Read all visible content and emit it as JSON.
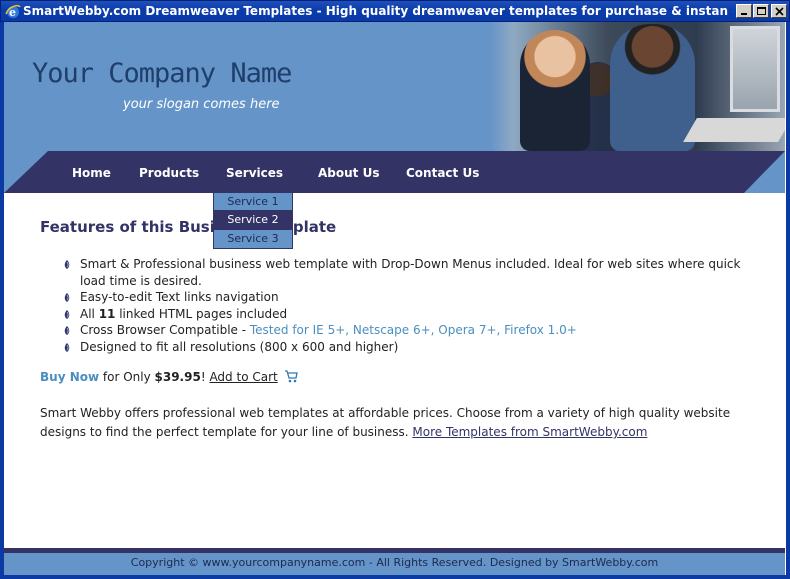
{
  "window": {
    "title": "SmartWebby.com Dreamweaver Templates - High quality dreamweaver templates for purchase & instan - Windows Interne...",
    "controls": [
      "minimize",
      "maximize",
      "close"
    ]
  },
  "header": {
    "company_name": "Your Company Name",
    "slogan": "your slogan comes here"
  },
  "nav": {
    "items": [
      {
        "label": "Home"
      },
      {
        "label": "Products"
      },
      {
        "label": "Services"
      },
      {
        "label": "About Us"
      },
      {
        "label": "Contact Us"
      }
    ]
  },
  "dropdown": {
    "items": [
      {
        "label": "Service 1"
      },
      {
        "label": "Service 2"
      },
      {
        "label": "Service 3"
      }
    ],
    "highlighted_index": 1
  },
  "content": {
    "heading": "Features of this Business Template",
    "features": [
      {
        "text": "Smart & Professional business web template with Drop-Down Menus included. Ideal for web sites where quick load time is desired."
      },
      {
        "text": "Easy-to-edit Text links navigation"
      },
      {
        "prefix": "All ",
        "bold": "11",
        "suffix": " linked HTML pages included"
      },
      {
        "text": "Cross Browser Compatible - ",
        "highlight": "Tested for IE 5+, Netscape 6+, Opera 7+, Firefox 1.0+"
      },
      {
        "text": "Designed to fit all resolutions (800 x 600 and higher)"
      }
    ],
    "buy": {
      "buy_now": "Buy Now",
      "for_only": " for Only ",
      "price": "$39.95",
      "excl": "! ",
      "add_to_cart": "Add to Cart"
    },
    "about": {
      "text": "Smart Webby offers professional web templates at affordable prices. Choose from a variety of high quality website designs to find the perfect template for your line of business. ",
      "link": "More Templates from SmartWebby.com"
    }
  },
  "footer": {
    "copyright": "Copyright © www.yourcompanyname.com - All Rights Reserved. Designed by SmartWebby.com"
  },
  "colors": {
    "header_bg": "#6594c8",
    "nav_bg": "#333366",
    "title_bar": "#0a3cad",
    "link_blue": "#4a8fbf",
    "heading": "#333366"
  },
  "icons": [
    "ie-icon",
    "minimize-icon",
    "maximize-icon",
    "close-icon",
    "bullet-icon",
    "cart-icon"
  ]
}
